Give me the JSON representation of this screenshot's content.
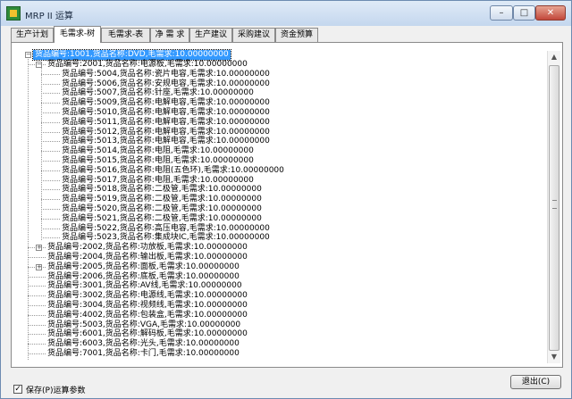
{
  "window": {
    "title": "MRP II 运算"
  },
  "tabs": [
    {
      "label": "生产计划",
      "active": false
    },
    {
      "label": "毛需求-树",
      "active": true
    },
    {
      "label": "毛需求-表",
      "active": false
    },
    {
      "label": "净 需 求",
      "active": false
    },
    {
      "label": "生产建议",
      "active": false
    },
    {
      "label": "采购建议",
      "active": false
    },
    {
      "label": "资金预算",
      "active": false
    }
  ],
  "tree": {
    "root": {
      "text": "货品编号:1001,货品名称:DVD,毛需求:10.00000000",
      "expanded": true,
      "selected": true
    },
    "items": [
      {
        "text": "货品编号:2001,货品名称:电源板,毛需求:10.00000000",
        "level": 1,
        "expander": "minus"
      },
      {
        "text": "货品编号:5004,货品名称:瓷片电容,毛需求:10.00000000",
        "level": 2
      },
      {
        "text": "货品编号:5006,货品名称:安规电容,毛需求:10.00000000",
        "level": 2
      },
      {
        "text": "货品编号:5007,货品名称:针座,毛需求:10.00000000",
        "level": 2
      },
      {
        "text": "货品编号:5009,货品名称:电解电容,毛需求:10.00000000",
        "level": 2
      },
      {
        "text": "货品编号:5010,货品名称:电解电容,毛需求:10.00000000",
        "level": 2
      },
      {
        "text": "货品编号:5011,货品名称:电解电容,毛需求:10.00000000",
        "level": 2
      },
      {
        "text": "货品编号:5012,货品名称:电解电容,毛需求:10.00000000",
        "level": 2
      },
      {
        "text": "货品编号:5013,货品名称:电解电容,毛需求:10.00000000",
        "level": 2
      },
      {
        "text": "货品编号:5014,货品名称:电阻,毛需求:10.00000000",
        "level": 2
      },
      {
        "text": "货品编号:5015,货品名称:电阻,毛需求:10.00000000",
        "level": 2
      },
      {
        "text": "货品编号:5016,货品名称:电阻(五色环),毛需求:10.00000000",
        "level": 2
      },
      {
        "text": "货品编号:5017,货品名称:电阻,毛需求:10.00000000",
        "level": 2
      },
      {
        "text": "货品编号:5018,货品名称:二极管,毛需求:10.00000000",
        "level": 2
      },
      {
        "text": "货品编号:5019,货品名称:二极管,毛需求:10.00000000",
        "level": 2
      },
      {
        "text": "货品编号:5020,货品名称:二极管,毛需求:10.00000000",
        "level": 2
      },
      {
        "text": "货品编号:5021,货品名称:二极管,毛需求:10.00000000",
        "level": 2
      },
      {
        "text": "货品编号:5022,货品名称:高压电容,毛需求:10.00000000",
        "level": 2
      },
      {
        "text": "货品编号:5023,货品名称:集成块IC,毛需求:10.00000000",
        "level": 2
      },
      {
        "text": "货品编号:2002,货品名称:功放板,毛需求:10.00000000",
        "level": 1,
        "expander": "plus"
      },
      {
        "text": "货品编号:2004,货品名称:输出板,毛需求:10.00000000",
        "level": 1
      },
      {
        "text": "货品编号:2005,货品名称:面板,毛需求:10.00000000",
        "level": 1,
        "expander": "plus"
      },
      {
        "text": "货品编号:2006,货品名称:底板,毛需求:10.00000000",
        "level": 1
      },
      {
        "text": "货品编号:3001,货品名称:AV线,毛需求:10.00000000",
        "level": 1
      },
      {
        "text": "货品编号:3002,货品名称:电源线,毛需求:10.00000000",
        "level": 1
      },
      {
        "text": "货品编号:3004,货品名称:视频线,毛需求:10.00000000",
        "level": 1
      },
      {
        "text": "货品编号:4002,货品名称:包装盒,毛需求:10.00000000",
        "level": 1
      },
      {
        "text": "货品编号:5003,货品名称:VGA,毛需求:10.00000000",
        "level": 1
      },
      {
        "text": "货品编号:6001,货品名称:解码板,毛需求:10.00000000",
        "level": 1
      },
      {
        "text": "货品编号:6003,货品名称:光头,毛需求:10.00000000",
        "level": 1
      },
      {
        "text": "货品编号:7001,货品名称:卡门,毛需求:10.00000000",
        "level": 1
      }
    ]
  },
  "footer": {
    "save_params_label": "保存(P)运算参数",
    "save_params_checked": true,
    "exit_label": "退出(C)"
  },
  "window_controls": {
    "min": "–",
    "max": "□",
    "close": "✕"
  },
  "colors": {
    "selection": "#3399ff",
    "titlebar": "#c4d7ee",
    "close_button": "#c2473a"
  }
}
